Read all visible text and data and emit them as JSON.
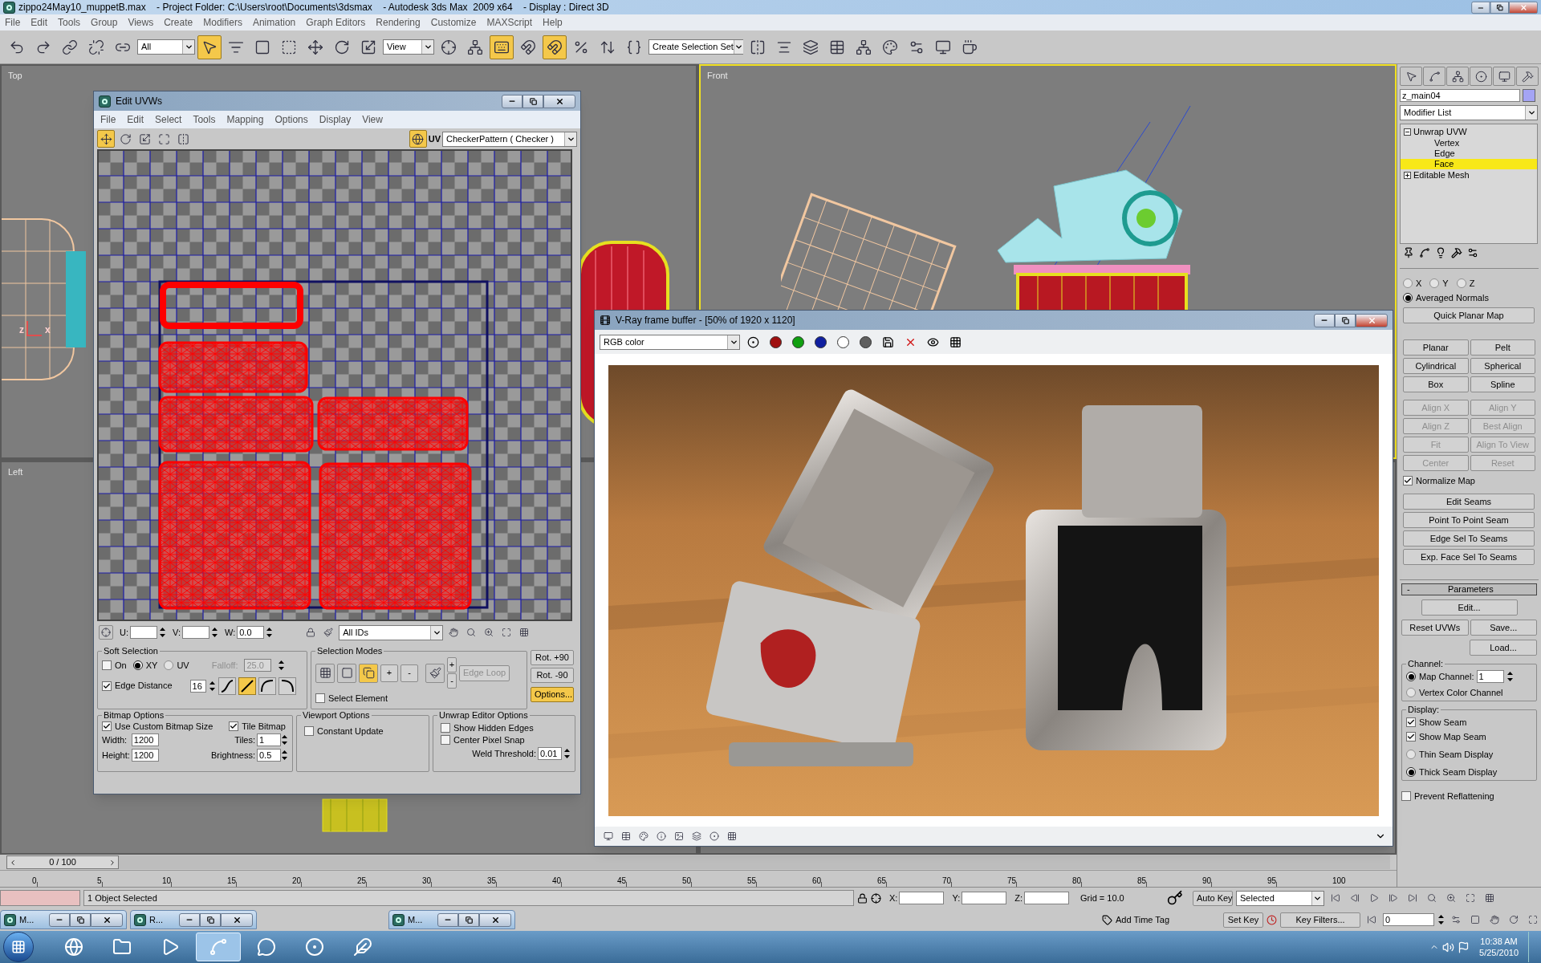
{
  "app_title": "zippo24May10_muppetB.max    - Project Folder: C:\\Users\\root\\Documents\\3dsmax    - Autodesk 3ds Max  2009 x64    - Display : Direct 3D",
  "menu": [
    "File",
    "Edit",
    "Tools",
    "Group",
    "Views",
    "Create",
    "Modifiers",
    "Animation",
    "Graph Editors",
    "Rendering",
    "Customize",
    "MAXScript",
    "Help"
  ],
  "toolbar": [
    {
      "kind": "button",
      "selected": false
    },
    {
      "kind": "button",
      "selected": false
    },
    {
      "kind": "button",
      "selected": false
    },
    {
      "kind": "button",
      "selected": false
    },
    {
      "kind": "button",
      "selected": false
    },
    {
      "kind": "dropdown",
      "value": "All"
    },
    {
      "kind": "button",
      "selected": true
    },
    {
      "kind": "button",
      "selected": false
    },
    {
      "kind": "button",
      "selected": false
    },
    {
      "kind": "button",
      "selected": false
    },
    {
      "kind": "button",
      "selected": false
    },
    {
      "kind": "button",
      "selected": false
    },
    {
      "kind": "button",
      "selected": false
    },
    {
      "kind": "dropdown",
      "value": "View"
    },
    {
      "kind": "button",
      "selected": false
    },
    {
      "kind": "button",
      "selected": false
    },
    {
      "kind": "button",
      "selected": true
    },
    {
      "kind": "button",
      "selected": false
    },
    {
      "kind": "button",
      "selected": true
    },
    {
      "kind": "button",
      "selected": false
    },
    {
      "kind": "button",
      "selected": false
    },
    {
      "kind": "button",
      "selected": false
    },
    {
      "kind": "dropdown",
      "value": "Create Selection Set"
    },
    {
      "kind": "button",
      "selected": false
    },
    {
      "kind": "button",
      "selected": false
    },
    {
      "kind": "button",
      "selected": false
    },
    {
      "kind": "button",
      "selected": false
    },
    {
      "kind": "button",
      "selected": false
    },
    {
      "kind": "button",
      "selected": false
    },
    {
      "kind": "button",
      "selected": false
    },
    {
      "kind": "button",
      "selected": false
    },
    {
      "kind": "button",
      "selected": false
    }
  ],
  "viewports": [
    {
      "label": "Top",
      "active": false,
      "axes": [
        "z",
        "x"
      ]
    },
    {
      "label": "Front",
      "active": true
    },
    {
      "label": "Left",
      "active": false
    },
    {
      "active": false
    }
  ],
  "command_panel": {
    "object_name": "z_main04",
    "modifier_list": "Modifier List",
    "stack": [
      {
        "label": "Unwrap UVW",
        "expanded": true,
        "children": [
          {
            "label": "Vertex",
            "selected": false
          },
          {
            "label": "Edge",
            "selected": false
          },
          {
            "label": "Face",
            "selected": true
          }
        ]
      },
      {
        "label": "Editable Mesh",
        "expanded": false
      }
    ],
    "axis_radios": [
      {
        "label": "X",
        "selected": false
      },
      {
        "label": "Y",
        "selected": false
      },
      {
        "label": "Z",
        "selected": false
      }
    ],
    "averaged_normals": {
      "label": "Averaged Normals",
      "selected": true
    },
    "quick_planar": "Quick Planar Map",
    "map_buttons": [
      {
        "label": "Planar",
        "disabled": false
      },
      {
        "label": "Pelt",
        "disabled": false
      },
      {
        "label": "Cylindrical",
        "disabled": false
      },
      {
        "label": "Spherical",
        "disabled": false
      },
      {
        "label": "Box",
        "disabled": false
      },
      {
        "label": "Spline",
        "disabled": false
      },
      {
        "label": "Align X",
        "disabled": true
      },
      {
        "label": "Align Y",
        "disabled": true
      },
      {
        "label": "Align Z",
        "disabled": true
      },
      {
        "label": "Best Align",
        "disabled": true
      },
      {
        "label": "Fit",
        "disabled": true
      },
      {
        "label": "Align To View",
        "disabled": true
      },
      {
        "label": "Center",
        "disabled": true
      },
      {
        "label": "Reset",
        "disabled": true
      }
    ],
    "normalize_map": {
      "label": "Normalize Map",
      "checked": true
    },
    "seam_buttons": [
      "Edit Seams",
      "Point To Point Seam",
      "Edge Sel To Seams",
      "Exp. Face Sel To Seams"
    ],
    "parameters": {
      "toggle": "-",
      "title": "Parameters",
      "edit": "Edit...",
      "reset": "Reset UVWs",
      "save": "Save...",
      "load": "Load...",
      "channel": {
        "title": "Channel:",
        "map_channel": {
          "label": "Map Channel:",
          "selected": true,
          "value": "1"
        },
        "vertex_color": {
          "label": "Vertex Color Channel",
          "selected": false
        }
      },
      "display": {
        "title": "Display:",
        "checks": [
          {
            "label": "Show Seam",
            "checked": true
          },
          {
            "label": "Show Map Seam",
            "checked": true
          }
        ],
        "options": [
          {
            "label": "Thin Seam Display",
            "selected": false
          },
          {
            "label": "Thick Seam Display",
            "selected": true
          }
        ]
      },
      "prevent_reflattening": {
        "label": "Prevent Reflattening",
        "checked": false
      }
    }
  },
  "uv_editor": {
    "title": "Edit UVWs",
    "menu": [
      "File",
      "Edit",
      "Select",
      "Tools",
      "Mapping",
      "Options",
      "Display",
      "View"
    ],
    "tools": [
      {
        "selected": true
      },
      {
        "selected": false
      },
      {
        "selected": false
      },
      {
        "selected": false
      },
      {
        "selected": false
      }
    ],
    "uv_label": "UV",
    "texture": "CheckerPattern  ( Checker )",
    "coords": [
      {
        "label": "U:"
      },
      {
        "label": "V:"
      },
      {
        "label": "W:",
        "value": "0.0"
      }
    ],
    "ids": "All IDs",
    "soft_selection": {
      "title": "Soft Selection",
      "on": {
        "label": "On",
        "checked": false
      },
      "spaces": [
        {
          "label": "XY",
          "selected": true
        },
        {
          "label": "UV",
          "selected": false
        }
      ],
      "falloff": {
        "label": "Falloff:",
        "value": "25.0",
        "disabled": true
      },
      "edge_distance": {
        "label": "Edge Distance",
        "checked": true,
        "value": "16"
      },
      "curves": [
        {
          "selected": false
        },
        {
          "selected": true
        },
        {
          "selected": false
        },
        {
          "selected": false
        }
      ]
    },
    "selection_modes": {
      "title": "Selection Modes",
      "modes": [
        {
          "selected": false
        },
        {
          "selected": false
        },
        {
          "selected": true
        }
      ],
      "grow": "+",
      "shrink": "-",
      "loop_grow": "+",
      "loop_shrink": "-",
      "edge_loop": {
        "label": "Edge Loop",
        "disabled": true
      },
      "select_element": {
        "label": "Select Element",
        "checked": false
      }
    },
    "rotate": [
      "Rot. +90",
      "Rot. -90"
    ],
    "options": {
      "label": "Options...",
      "selected": true
    },
    "bitmap_options": {
      "title": "Bitmap Options",
      "custom_size": {
        "label": "Use Custom Bitmap Size",
        "checked": true
      },
      "tile": {
        "label": "Tile Bitmap",
        "checked": true
      },
      "width": {
        "label": "Width:",
        "value": "1200"
      },
      "height": {
        "label": "Height:",
        "value": "1200"
      },
      "tiles": {
        "label": "Tiles:",
        "value": "1"
      },
      "brightness": {
        "label": "Brightness:",
        "value": "0.5"
      }
    },
    "viewport_options": {
      "title": "Viewport Options",
      "constant_update": {
        "label": "Constant Update",
        "checked": false
      }
    },
    "editor_options": {
      "title": "Unwrap Editor Options",
      "checks": [
        {
          "label": "Show Hidden Edges",
          "checked": false
        },
        {
          "label": "Center Pixel Snap",
          "checked": false
        }
      ],
      "weld": {
        "label": "Weld Threshold:",
        "value": "0.01"
      }
    }
  },
  "vray": {
    "title": "V-Ray frame buffer - [50% of 1920 x 1120]",
    "channel": "RGB color"
  },
  "timeline": {
    "frame": "0 / 100",
    "level": 0,
    "ticks": [
      "0",
      "5",
      "10",
      "15",
      "20",
      "25",
      "30",
      "35",
      "40",
      "45",
      "50",
      "55",
      "60",
      "65",
      "70",
      "75",
      "80",
      "85",
      "90",
      "95",
      "100"
    ]
  },
  "status": {
    "selection": "1 Object Selected",
    "coords": [
      "X:",
      "Y:",
      "Z:"
    ],
    "grid": "Grid = 10.0",
    "auto_key": "Auto Key",
    "key_mode": "Selected",
    "set_key": "Set Key",
    "key_filters": "Key Filters...",
    "time_tag": "Add Time Tag",
    "frame": "0"
  },
  "minimized": [
    "M...",
    "R...",
    "M..."
  ],
  "taskbar": {
    "apps": [
      {
        "selected": false
      },
      {
        "selected": false
      },
      {
        "selected": false
      },
      {
        "selected": true
      },
      {
        "selected": false
      },
      {
        "selected": false
      },
      {
        "selected": false
      }
    ],
    "time": "10:38 AM",
    "date": "5/25/2010"
  }
}
